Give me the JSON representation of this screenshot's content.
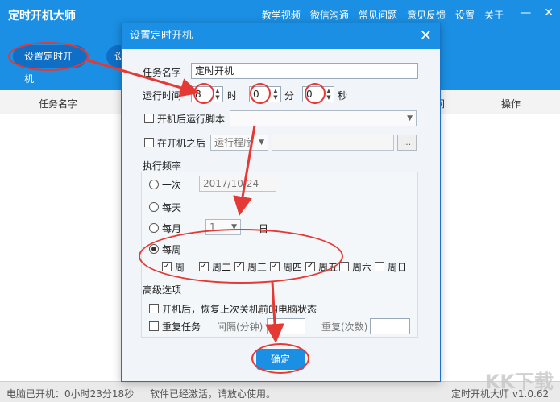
{
  "app": {
    "title": "定时开机大师",
    "nav": [
      "教学视频",
      "微信沟通",
      "常见问题",
      "意见反馈",
      "设置",
      "关于"
    ],
    "window_controls": [
      "—",
      "✕"
    ],
    "buttons": {
      "primary": "设置定时开机",
      "secondary": "设"
    }
  },
  "table": {
    "headers": {
      "task_name": "任务名字",
      "time": "间",
      "ops": "操作"
    }
  },
  "status": {
    "uptime": "电脑已开机：0小时23分18秒",
    "activation": "软件已经激活，请放心使用。",
    "product": "定时开机大师 v1.0.62",
    "watermark": "KK下载"
  },
  "dialog": {
    "title": "设置定时开机",
    "close": "✕",
    "task_name_label": "任务名字",
    "task_name_value": "定时开机",
    "run_time_label": "运行时间",
    "hour_value": "8",
    "hour_unit": "时",
    "minute_value": "0",
    "minute_unit": "分",
    "second_value": "0",
    "second_unit": "秒",
    "run_script_label": "开机后运行脚本",
    "after_boot_label": "在开机之后",
    "program_select": "运行程序",
    "browse": "...",
    "frequency_label": "执行频率",
    "freq_once": "一次",
    "date_value": "2017/10/24",
    "freq_daily": "每天",
    "freq_monthly": "每月",
    "month_day_value": "1",
    "month_day_unit": "日",
    "freq_weekly": "每周",
    "weekdays": [
      "周一",
      "周二",
      "周三",
      "周四",
      "周五",
      "周六",
      "周日"
    ],
    "weekdays_checked": [
      true,
      true,
      true,
      true,
      true,
      false,
      false
    ],
    "advanced_label": "高级选项",
    "restore_state_label": "开机后，恢复上次关机前的电脑状态",
    "repeat_task_label": "重复任务",
    "interval_label": "间隔(分钟)",
    "repeat_count_label": "重复(次数)",
    "ok": "确定"
  },
  "colors": {
    "accent": "#1a8fe3",
    "annotation": "#e53935"
  }
}
